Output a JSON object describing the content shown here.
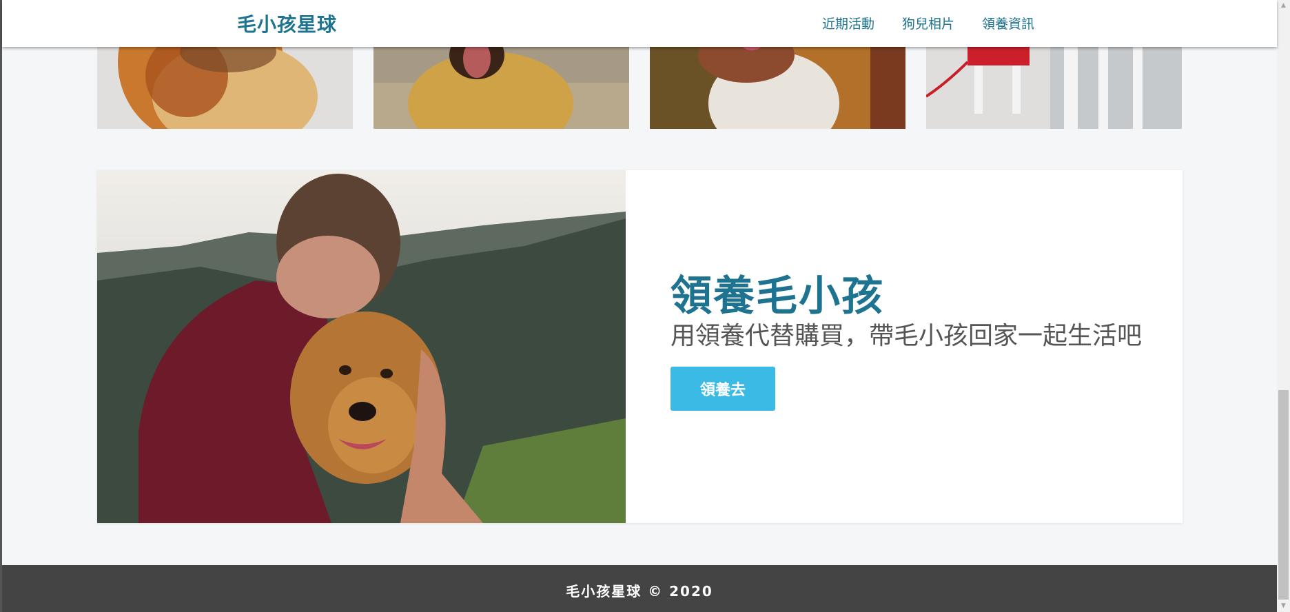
{
  "header": {
    "brand": "毛小孩星球",
    "nav": [
      {
        "label": "近期活動"
      },
      {
        "label": "狗兒相片"
      },
      {
        "label": "領養資訊"
      }
    ]
  },
  "gallery": {
    "photos": [
      {
        "icon": "dog-photo-1"
      },
      {
        "icon": "dog-photo-2"
      },
      {
        "icon": "dog-photo-3"
      },
      {
        "icon": "dog-photo-4"
      }
    ]
  },
  "adopt": {
    "title": "領養毛小孩",
    "subtitle": "用領養代替購買，帶毛小孩回家一起生活吧",
    "button_label": "領養去"
  },
  "footer": {
    "text": "毛小孩星球 © 2020"
  },
  "colors": {
    "brand": "#1e7490",
    "button": "#3bbae6",
    "footer_bg": "#444444",
    "page_bg": "#f4f6f8"
  },
  "scrollbar": {
    "up_icon": "▲",
    "down_icon": "▼"
  }
}
